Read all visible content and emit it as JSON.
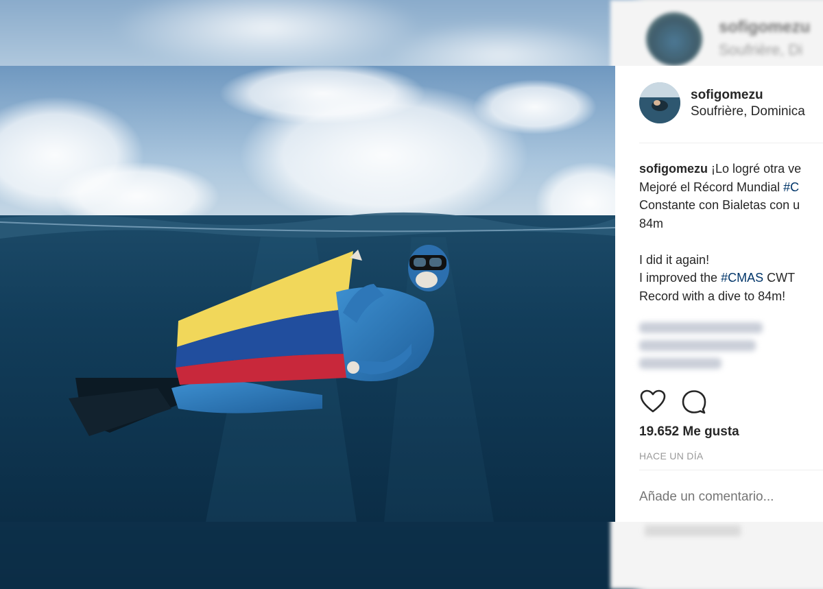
{
  "post": {
    "username": "sofigomezu",
    "location": "Soufrière, Dominica",
    "caption_lines": [
      {
        "text": "¡Lo logré otra ve"
      },
      {
        "prefix": "Mejoré el Récord Mundial ",
        "hashtag": "#C"
      },
      {
        "text": "Constante con Bialetas con u"
      },
      {
        "text": "84m"
      },
      {
        "text": ""
      },
      {
        "text": "I did it again!"
      },
      {
        "prefix": "I improved the ",
        "hashtag": "#CMAS",
        "suffix": " CWT"
      },
      {
        "text": "Record with a dive to 84m!"
      }
    ],
    "likes": "19.652 Me gusta",
    "timestamp": "HACE UN DÍA",
    "comment_placeholder": "Añade un comentario..."
  },
  "background": {
    "username": "sofigomezu",
    "location": "Soufrière, Di"
  },
  "icons": {
    "like": "heart-icon",
    "comment": "speech-bubble-icon"
  },
  "colors": {
    "hashtag": "#003569",
    "text": "#262626",
    "muted": "#999999",
    "sky": "#8fb3d3",
    "water": "#0e3652"
  }
}
